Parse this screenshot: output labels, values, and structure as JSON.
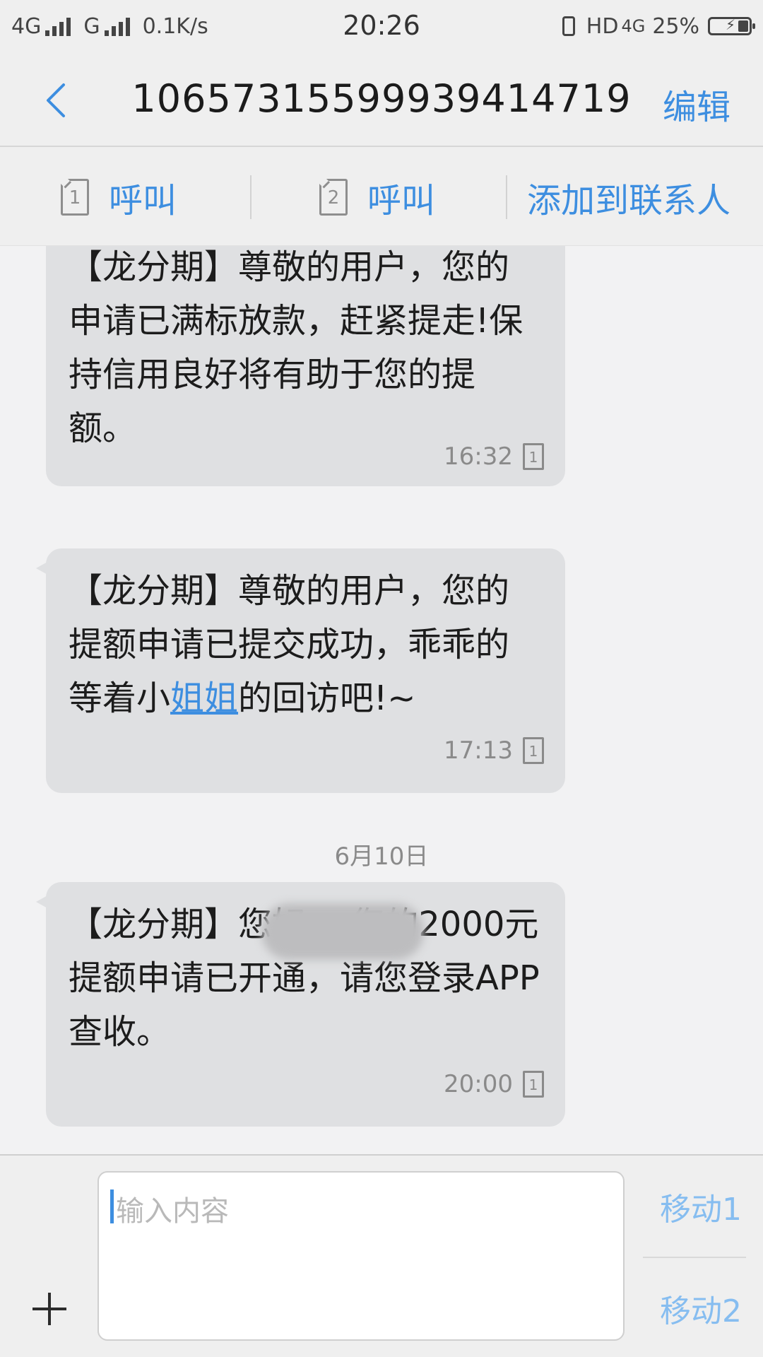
{
  "status_bar": {
    "network1": "4G",
    "network2": "G",
    "speed": "0.1K/s",
    "time": "20:26",
    "hd": "HD",
    "net4g": "4G",
    "battery": "25%"
  },
  "header": {
    "title": "1065731559993941​4719",
    "edit": "编辑"
  },
  "actions": {
    "call1_sim": "1",
    "call1": "呼叫",
    "call2_sim": "2",
    "call2": "呼叫",
    "add_contact": "添加到联系人"
  },
  "messages": [
    {
      "text": "【龙分期】尊敬的用户，您的申请已满标放款，赶紧提走!保持信用良好将有助于您的提额。",
      "time": "16:32",
      "sim": "1"
    },
    {
      "text_before": "【龙分期】尊敬的用户，您的提额申请已提交成功，乖乖的等着小",
      "link": "姐姐",
      "text_after": "的回访吧!~",
      "time": "17:13",
      "sim": "1"
    },
    {
      "text": "【龙分期】您好        ，您的2000元提额申请已开通，请您登录APP查收。",
      "time": "20:00",
      "sim": "1"
    }
  ],
  "date_separator": "6月10日",
  "input": {
    "placeholder": "输入内容",
    "send1": "移动1",
    "send2": "移动2"
  }
}
